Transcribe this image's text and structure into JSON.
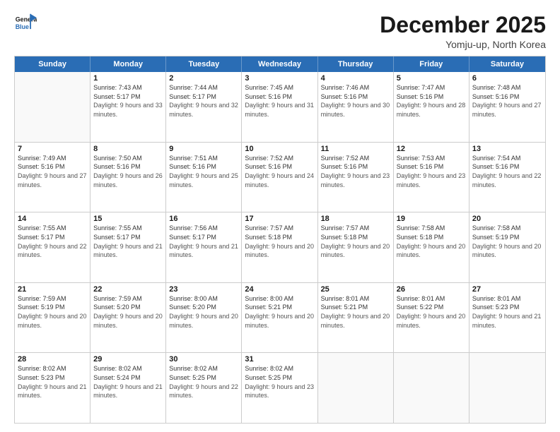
{
  "logo": {
    "line1": "General",
    "line2": "Blue"
  },
  "header": {
    "month": "December 2025",
    "location": "Yomju-up, North Korea"
  },
  "weekdays": [
    "Sunday",
    "Monday",
    "Tuesday",
    "Wednesday",
    "Thursday",
    "Friday",
    "Saturday"
  ],
  "rows": [
    [
      {
        "day": "",
        "sunrise": "",
        "sunset": "",
        "daylight": ""
      },
      {
        "day": "1",
        "sunrise": "7:43 AM",
        "sunset": "5:17 PM",
        "daylight": "9 hours and 33 minutes."
      },
      {
        "day": "2",
        "sunrise": "7:44 AM",
        "sunset": "5:17 PM",
        "daylight": "9 hours and 32 minutes."
      },
      {
        "day": "3",
        "sunrise": "7:45 AM",
        "sunset": "5:16 PM",
        "daylight": "9 hours and 31 minutes."
      },
      {
        "day": "4",
        "sunrise": "7:46 AM",
        "sunset": "5:16 PM",
        "daylight": "9 hours and 30 minutes."
      },
      {
        "day": "5",
        "sunrise": "7:47 AM",
        "sunset": "5:16 PM",
        "daylight": "9 hours and 28 minutes."
      },
      {
        "day": "6",
        "sunrise": "7:48 AM",
        "sunset": "5:16 PM",
        "daylight": "9 hours and 27 minutes."
      }
    ],
    [
      {
        "day": "7",
        "sunrise": "7:49 AM",
        "sunset": "5:16 PM",
        "daylight": "9 hours and 27 minutes."
      },
      {
        "day": "8",
        "sunrise": "7:50 AM",
        "sunset": "5:16 PM",
        "daylight": "9 hours and 26 minutes."
      },
      {
        "day": "9",
        "sunrise": "7:51 AM",
        "sunset": "5:16 PM",
        "daylight": "9 hours and 25 minutes."
      },
      {
        "day": "10",
        "sunrise": "7:52 AM",
        "sunset": "5:16 PM",
        "daylight": "9 hours and 24 minutes."
      },
      {
        "day": "11",
        "sunrise": "7:52 AM",
        "sunset": "5:16 PM",
        "daylight": "9 hours and 23 minutes."
      },
      {
        "day": "12",
        "sunrise": "7:53 AM",
        "sunset": "5:16 PM",
        "daylight": "9 hours and 23 minutes."
      },
      {
        "day": "13",
        "sunrise": "7:54 AM",
        "sunset": "5:16 PM",
        "daylight": "9 hours and 22 minutes."
      }
    ],
    [
      {
        "day": "14",
        "sunrise": "7:55 AM",
        "sunset": "5:17 PM",
        "daylight": "9 hours and 22 minutes."
      },
      {
        "day": "15",
        "sunrise": "7:55 AM",
        "sunset": "5:17 PM",
        "daylight": "9 hours and 21 minutes."
      },
      {
        "day": "16",
        "sunrise": "7:56 AM",
        "sunset": "5:17 PM",
        "daylight": "9 hours and 21 minutes."
      },
      {
        "day": "17",
        "sunrise": "7:57 AM",
        "sunset": "5:18 PM",
        "daylight": "9 hours and 20 minutes."
      },
      {
        "day": "18",
        "sunrise": "7:57 AM",
        "sunset": "5:18 PM",
        "daylight": "9 hours and 20 minutes."
      },
      {
        "day": "19",
        "sunrise": "7:58 AM",
        "sunset": "5:18 PM",
        "daylight": "9 hours and 20 minutes."
      },
      {
        "day": "20",
        "sunrise": "7:58 AM",
        "sunset": "5:19 PM",
        "daylight": "9 hours and 20 minutes."
      }
    ],
    [
      {
        "day": "21",
        "sunrise": "7:59 AM",
        "sunset": "5:19 PM",
        "daylight": "9 hours and 20 minutes."
      },
      {
        "day": "22",
        "sunrise": "7:59 AM",
        "sunset": "5:20 PM",
        "daylight": "9 hours and 20 minutes."
      },
      {
        "day": "23",
        "sunrise": "8:00 AM",
        "sunset": "5:20 PM",
        "daylight": "9 hours and 20 minutes."
      },
      {
        "day": "24",
        "sunrise": "8:00 AM",
        "sunset": "5:21 PM",
        "daylight": "9 hours and 20 minutes."
      },
      {
        "day": "25",
        "sunrise": "8:01 AM",
        "sunset": "5:21 PM",
        "daylight": "9 hours and 20 minutes."
      },
      {
        "day": "26",
        "sunrise": "8:01 AM",
        "sunset": "5:22 PM",
        "daylight": "9 hours and 20 minutes."
      },
      {
        "day": "27",
        "sunrise": "8:01 AM",
        "sunset": "5:23 PM",
        "daylight": "9 hours and 21 minutes."
      }
    ],
    [
      {
        "day": "28",
        "sunrise": "8:02 AM",
        "sunset": "5:23 PM",
        "daylight": "9 hours and 21 minutes."
      },
      {
        "day": "29",
        "sunrise": "8:02 AM",
        "sunset": "5:24 PM",
        "daylight": "9 hours and 21 minutes."
      },
      {
        "day": "30",
        "sunrise": "8:02 AM",
        "sunset": "5:25 PM",
        "daylight": "9 hours and 22 minutes."
      },
      {
        "day": "31",
        "sunrise": "8:02 AM",
        "sunset": "5:25 PM",
        "daylight": "9 hours and 23 minutes."
      },
      {
        "day": "",
        "sunrise": "",
        "sunset": "",
        "daylight": ""
      },
      {
        "day": "",
        "sunrise": "",
        "sunset": "",
        "daylight": ""
      },
      {
        "day": "",
        "sunrise": "",
        "sunset": "",
        "daylight": ""
      }
    ]
  ]
}
